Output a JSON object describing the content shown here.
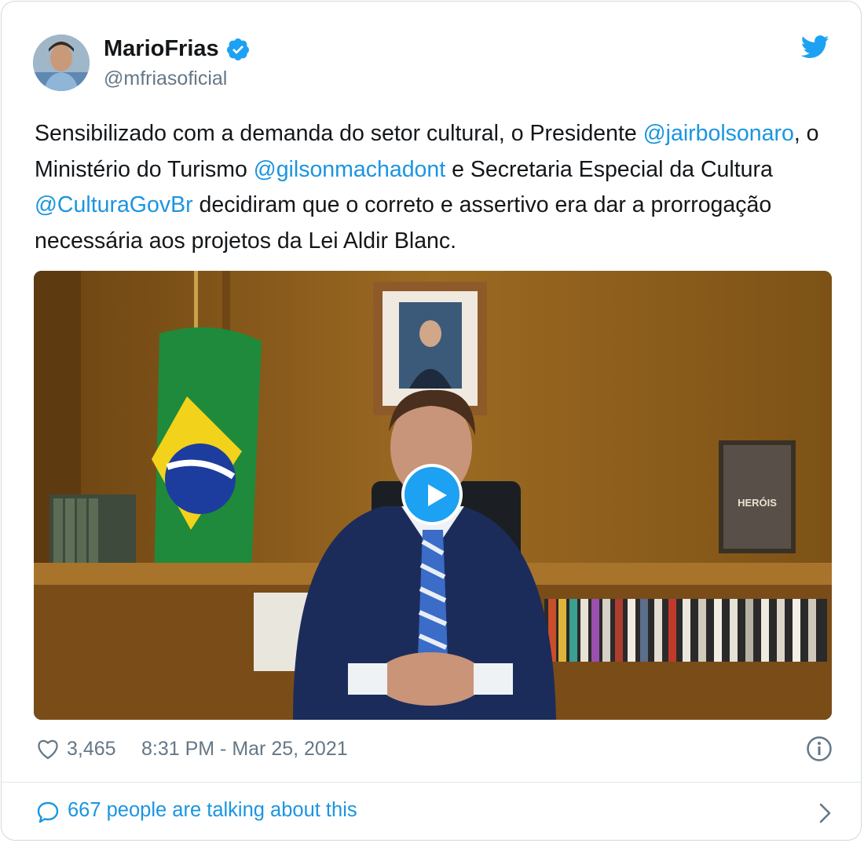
{
  "author": {
    "name": "MarioFrias",
    "handle": "@mfriasoficial",
    "verified": true
  },
  "tweet": {
    "segments": [
      {
        "text": "Sensibilizado com a demanda do setor cultural, o Presidente ",
        "type": "text"
      },
      {
        "text": "@jairbolsonaro",
        "type": "mention"
      },
      {
        "text": ", o Ministério do Turismo ",
        "type": "text"
      },
      {
        "text": "@gilsonmachadont",
        "type": "mention"
      },
      {
        "text": " e Secretaria Especial da Cultura ",
        "type": "text"
      },
      {
        "text": "@CulturaGovBr",
        "type": "mention"
      },
      {
        "text": " decidiram que o correto e assertivo era dar a prorrogação necessária aos projetos da Lei Aldir Blanc.",
        "type": "text"
      }
    ]
  },
  "media": {
    "type": "video",
    "poster_sign_text": "HERÓIS"
  },
  "meta": {
    "like_count": "3,465",
    "timestamp": "8:31 PM - Mar 25, 2021"
  },
  "footer": {
    "talking_text": "667 people are talking about this"
  },
  "colors": {
    "link": "#1b95e0",
    "twitter_blue": "#1da1f2",
    "muted": "#657786"
  },
  "icons": [
    "verified-badge-icon",
    "twitter-bird-icon",
    "play-icon",
    "heart-icon",
    "info-icon",
    "speech-bubble-icon",
    "chevron-right-icon"
  ]
}
